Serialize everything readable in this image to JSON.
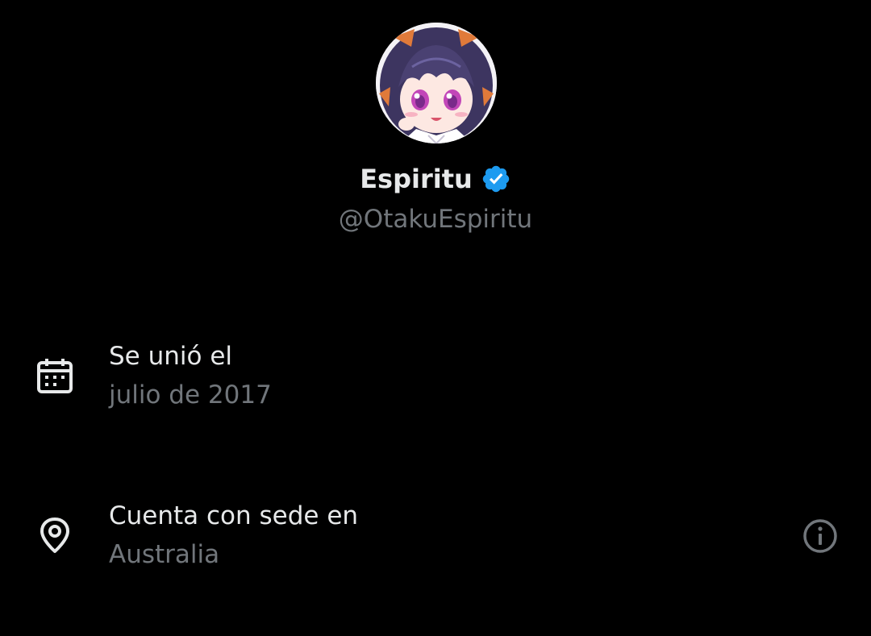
{
  "profile": {
    "display_name": "Espiritu",
    "handle": "@OtakuEspiritu",
    "verified": true,
    "avatar_icon": "anime-girl-avatar"
  },
  "about": {
    "joined": {
      "icon": "calendar-icon",
      "title": "Se unió el",
      "value": "julio de 2017"
    },
    "location": {
      "icon": "location-pin-icon",
      "title": "Cuenta con sede en",
      "value": "Australia",
      "info_icon": "info-icon"
    }
  },
  "colors": {
    "background": "#000000",
    "primary_text": "#e7e9ea",
    "secondary_text": "#71767b",
    "verified_badge": "#1d9bf0"
  }
}
